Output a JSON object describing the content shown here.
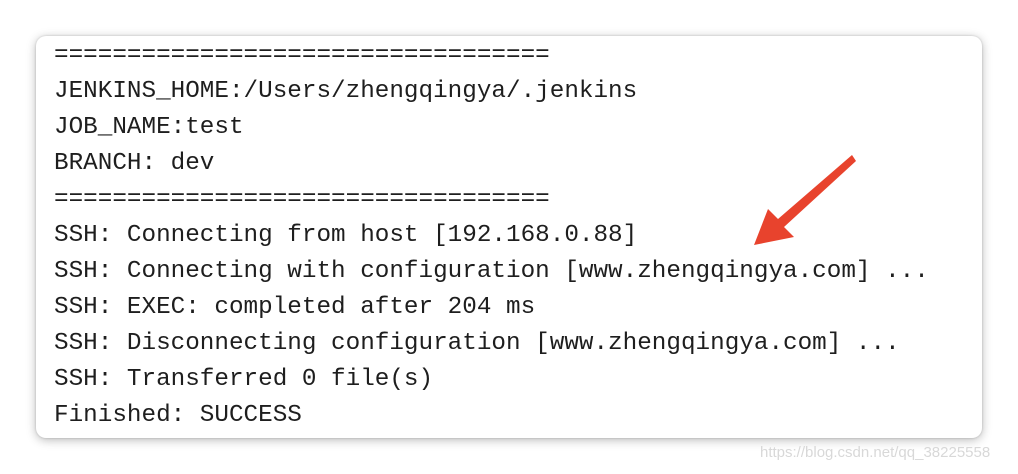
{
  "console": {
    "lines": [
      "==================================",
      "JENKINS_HOME:/Users/zhengqingya/.jenkins",
      "JOB_NAME:test",
      "BRANCH: dev",
      "==================================",
      "SSH: Connecting from host [192.168.0.88]",
      "SSH: Connecting with configuration [www.zhengqingya.com] ...",
      "SSH: EXEC: completed after 204 ms",
      "SSH: Disconnecting configuration [www.zhengqingya.com] ...",
      "SSH: Transferred 0 file(s)",
      "Finished: SUCCESS"
    ]
  },
  "annotation": {
    "arrow_color": "#e8432d",
    "arrow_icon": "arrow-pointer-icon"
  },
  "watermark": {
    "text": "https://blog.csdn.net/qq_38225558"
  }
}
